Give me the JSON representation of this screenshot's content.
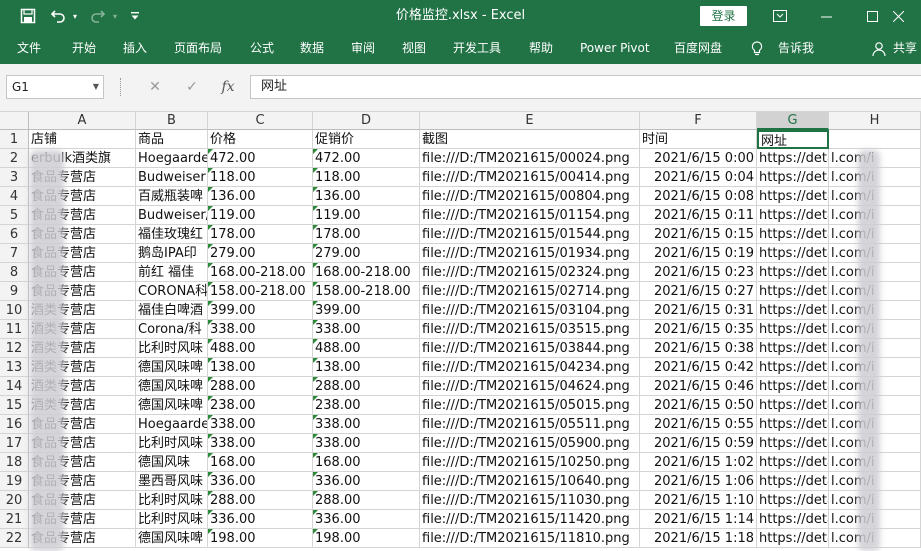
{
  "title_bar": {
    "document_title": "价格监控.xlsx  -  Excel",
    "login_label": "登录",
    "icons": [
      "save-icon",
      "undo-icon",
      "undo-dropdown-icon",
      "redo-icon",
      "redo-dropdown-icon",
      "customize-qat-icon",
      "ribbon-display-icon",
      "minimize-icon",
      "maximize-icon",
      "close-icon"
    ]
  },
  "ribbon": {
    "tabs": [
      "文件",
      "开始",
      "插入",
      "页面布局",
      "公式",
      "数据",
      "审阅",
      "视图",
      "开发工具",
      "帮助",
      "Power Pivot",
      "百度网盘"
    ],
    "tell_me": "告诉我",
    "share": "共享"
  },
  "formula_bar": {
    "name_box": "G1",
    "cancel_glyph": "✕",
    "enter_glyph": "✓",
    "fx_label": "fx",
    "formula_value": "网址"
  },
  "sheet": {
    "columns": [
      "A",
      "B",
      "C",
      "D",
      "E",
      "F",
      "G",
      "H"
    ],
    "selected_column": "G",
    "selected_cell": "G1",
    "rows": [
      {
        "n": "1",
        "a": "店铺",
        "b": "商品",
        "c": "价格",
        "d": "促销价",
        "e": "截图",
        "f": "时间",
        "g": "网址"
      },
      {
        "n": "2",
        "a": "erbulk酒类旗",
        "b": "Hoegaarde",
        "c": "472.00",
        "d": "472.00",
        "e": "file:///D:/TM2021615/00024.png",
        "f": "2021/6/15 0:00",
        "g": "https://detail.tm",
        "h": "l.com/i"
      },
      {
        "n": "3",
        "a": "食品专营店",
        "b": "Budweiser",
        "c": "118.00",
        "d": "118.00",
        "e": "file:///D:/TM2021615/00414.png",
        "f": "2021/6/15 0:04",
        "g": "https://detail.tm",
        "h": "l.com/i"
      },
      {
        "n": "4",
        "a": "食品专营店",
        "b": "百威瓶装啤",
        "c": "136.00",
        "d": "136.00",
        "e": "file:///D:/TM2021615/00804.png",
        "f": "2021/6/15 0:08",
        "g": "https://detail.tm",
        "h": "l.com/i"
      },
      {
        "n": "5",
        "a": "食品专营店",
        "b": "Budweiser/",
        "c": "119.00",
        "d": "119.00",
        "e": "file:///D:/TM2021615/01154.png",
        "f": "2021/6/15 0:11",
        "g": "https://detail.tm",
        "h": "l.com/i"
      },
      {
        "n": "6",
        "a": "食品专营店",
        "b": "福佳玫瑰红",
        "c": "178.00",
        "d": "178.00",
        "e": "file:///D:/TM2021615/01544.png",
        "f": "2021/6/15 0:15",
        "g": "https://detail.tm",
        "h": "l.com/i"
      },
      {
        "n": "7",
        "a": "食品专营店",
        "b": "鹅岛IPA印",
        "c": "279.00",
        "d": "279.00",
        "e": "file:///D:/TM2021615/01934.png",
        "f": "2021/6/15 0:19",
        "g": "https://detail.tm",
        "h": "l.com/i"
      },
      {
        "n": "8",
        "a": "食品专营店",
        "b": "前红 福佳",
        "c": "168.00-218.00",
        "d": "168.00-218.00",
        "e": "file:///D:/TM2021615/02324.png",
        "f": "2021/6/15 0:23",
        "g": "https://detail.tm",
        "h": "l.com/i"
      },
      {
        "n": "9",
        "a": "食品专营店",
        "b": "CORONA科",
        "c": "158.00-218.00",
        "d": "158.00-218.00",
        "e": "file:///D:/TM2021615/02714.png",
        "f": "2021/6/15 0:27",
        "g": "https://detail.tm",
        "h": "l.com/i"
      },
      {
        "n": "10",
        "a": "酒类专营店",
        "b": "福佳白啤酒",
        "c": "399.00",
        "d": "399.00",
        "e": "file:///D:/TM2021615/03104.png",
        "f": "2021/6/15 0:31",
        "g": "https://detail.tm",
        "h": "l.com/i"
      },
      {
        "n": "11",
        "a": "酒类专营店",
        "b": "Corona/科",
        "c": "338.00",
        "d": "338.00",
        "e": "file:///D:/TM2021615/03515.png",
        "f": "2021/6/15 0:35",
        "g": "https://detail.tm",
        "h": "l.com/i"
      },
      {
        "n": "12",
        "a": "酒类专营店",
        "b": "比利时风味",
        "c": "488.00",
        "d": "488.00",
        "e": "file:///D:/TM2021615/03844.png",
        "f": "2021/6/15 0:38",
        "g": "https://detail.tm",
        "h": "l.com/i"
      },
      {
        "n": "13",
        "a": "酒类专营店",
        "b": "德国风味啤",
        "c": "138.00",
        "d": "138.00",
        "e": "file:///D:/TM2021615/04234.png",
        "f": "2021/6/15 0:42",
        "g": "https://detail.tm",
        "h": "l.com/i"
      },
      {
        "n": "14",
        "a": "酒类专营店",
        "b": "德国风味啤",
        "c": "288.00",
        "d": "288.00",
        "e": "file:///D:/TM2021615/04624.png",
        "f": "2021/6/15 0:46",
        "g": "https://detail.tm",
        "h": "l.com/i"
      },
      {
        "n": "15",
        "a": "酒类专营店",
        "b": "德国风味啤",
        "c": "238.00",
        "d": "238.00",
        "e": "file:///D:/TM2021615/05015.png",
        "f": "2021/6/15 0:50",
        "g": "https://detail.tm",
        "h": "l.com/i"
      },
      {
        "n": "16",
        "a": "食品专营店",
        "b": "Hoegaarde",
        "c": "338.00",
        "d": "338.00",
        "e": "file:///D:/TM2021615/05511.png",
        "f": "2021/6/15 0:55",
        "g": "https://detail.tm",
        "h": "l.com/i"
      },
      {
        "n": "17",
        "a": "食品专营店",
        "b": "比利时风味",
        "c": "338.00",
        "d": "338.00",
        "e": "file:///D:/TM2021615/05900.png",
        "f": "2021/6/15 0:59",
        "g": "https://detail.tm",
        "h": "l.com/i"
      },
      {
        "n": "18",
        "a": "食品专营店",
        "b": "德国风味 ",
        "c": "168.00",
        "d": "168.00",
        "e": "file:///D:/TM2021615/10250.png",
        "f": "2021/6/15 1:02",
        "g": "https://detail.tm",
        "h": "l.com/i"
      },
      {
        "n": "19",
        "a": "食品专营店",
        "b": "墨西哥风味",
        "c": "336.00",
        "d": "336.00",
        "e": "file:///D:/TM2021615/10640.png",
        "f": "2021/6/15 1:06",
        "g": "https://detail.tm",
        "h": "l.com/i"
      },
      {
        "n": "20",
        "a": "食品专营店",
        "b": "比利时风味",
        "c": "288.00",
        "d": "288.00",
        "e": "file:///D:/TM2021615/11030.png",
        "f": "2021/6/15 1:10",
        "g": "https://detail.tm",
        "h": "l.com/i"
      },
      {
        "n": "21",
        "a": "食品专营店",
        "b": "比利时风味",
        "c": "336.00",
        "d": "336.00",
        "e": "file:///D:/TM2021615/11420.png",
        "f": "2021/6/15 1:14",
        "g": "https://detail.tm",
        "h": "l.com/i"
      },
      {
        "n": "22",
        "a": "食品专营店",
        "b": "德国风味啤",
        "c": "198.00",
        "d": "198.00",
        "e": "file:///D:/TM2021615/11810.png",
        "f": "2021/6/15 1:18",
        "g": "https://detail.tm",
        "h": "l.com/i"
      }
    ]
  },
  "colors": {
    "excel_green": "#217346",
    "header_gray": "#f3f3f3",
    "grid_line": "#d4d4d4"
  }
}
